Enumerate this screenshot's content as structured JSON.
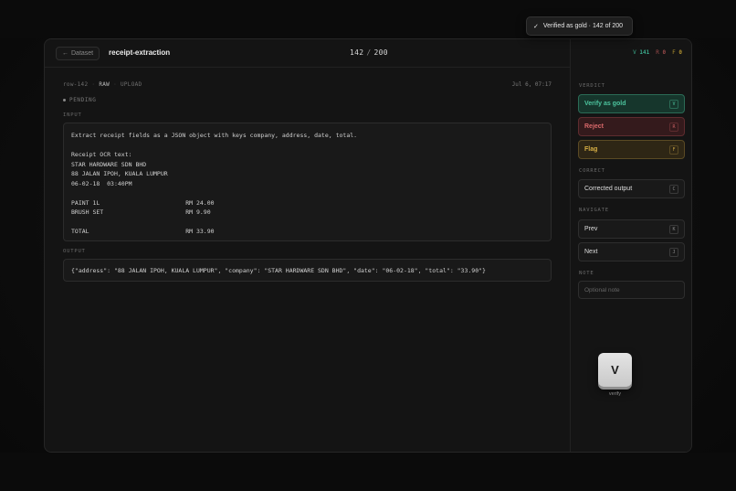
{
  "header": {
    "back_label": "Dataset",
    "title": "receipt-extraction",
    "counter_current": "142",
    "counter_sep": "/",
    "counter_total": "200"
  },
  "tallies": {
    "verified_letter": "V",
    "verified_count": "141",
    "rejected_letter": "R",
    "rejected_count": "0",
    "flagged_letter": "F",
    "flagged_count": "0"
  },
  "toast": {
    "text": "Verified as gold · 142 of 200"
  },
  "breadcrumb": [
    "row-142",
    "RAW",
    "UPLOAD"
  ],
  "timestamp": "Jul 6, 07:17",
  "status": "PENDING",
  "input": {
    "label": "INPUT",
    "text": "Extract receipt fields as a JSON object with keys company, address, date, total.\n\nReceipt OCR text:\nSTAR HARDWARE SDN BHD\n88 JALAN IPOH, KUALA LUMPUR\n06-02-18  03:40PM\n\nPAINT 1L                        RM 24.00\nBRUSH SET                       RM 9.90\n\nTOTAL                           RM 33.90"
  },
  "output": {
    "label": "OUTPUT",
    "text": "{\"address\": \"88 JALAN IPOH, KUALA LUMPUR\", \"company\": \"STAR HARDWARE SDN BHD\", \"date\": \"06-02-18\", \"total\": \"33.90\"}"
  },
  "sidebar": {
    "verdict_label": "VERDICT",
    "verify_label": "Verify as gold",
    "verify_key": "V",
    "reject_label": "Reject",
    "reject_key": "R",
    "flag_label": "Flag",
    "flag_key": "F",
    "correct_label": "CORRECT",
    "corrected_label": "Corrected output",
    "corrected_key": "C",
    "navigate_label": "NAVIGATE",
    "prev_label": "Prev",
    "prev_key": "K",
    "next_label": "Next",
    "next_key": "J",
    "note_label": "NOTE",
    "note_placeholder": "Optional note",
    "note_value": ""
  },
  "keycap": {
    "key": "V",
    "caption": "verify"
  },
  "colors": {
    "verify": "#4cc39d",
    "reject": "#d9686a",
    "flag": "#d8b045"
  },
  "icons": {
    "back": "arrow-left-icon",
    "toast": "checkmark-icon"
  }
}
